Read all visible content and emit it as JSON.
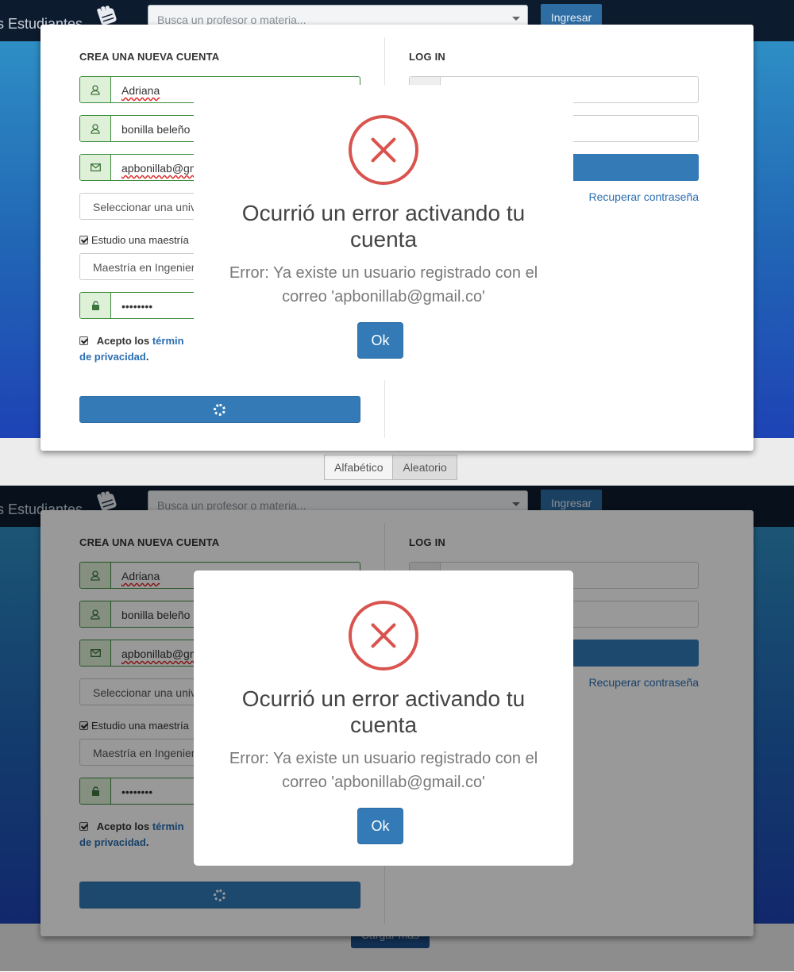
{
  "header": {
    "brand_text": "s Estudiantes",
    "search_placeholder": "Busca un profesor o materia...",
    "login_button": "Ingresar"
  },
  "sort": {
    "options": [
      "Alfabético",
      "Aleatorio"
    ],
    "active": "Aleatorio"
  },
  "load_more_label": "Cargar más",
  "register": {
    "title": "CREA UNA NUEVA CUENTA",
    "first_name": "Adriana",
    "last_name": "bonilla beleño",
    "email": "apbonillab@gm",
    "university": "Seleccionar una univ",
    "masters_checkbox_label": "Estudio una maestría",
    "masters_program": "Maestría en Ingenier",
    "password": "••••••••",
    "terms_prefix": "Acepto los ",
    "terms_link": "términ",
    "privacy_link": "de privacidad",
    "privacy_suffix": "."
  },
  "login": {
    "title": "LOG IN",
    "recover_link": "Recuperar contraseña"
  },
  "modal": {
    "icon": "error-x-icon",
    "title": "Ocurrió un error activando tu cuenta",
    "message": "Error: Ya existe un usuario registrado con el correo 'apbonillab@gmail.co'",
    "ok_button": "Ok"
  },
  "colors": {
    "primary": "#337ab7",
    "error": "#d9534f",
    "valid": "#3c8a3c",
    "navbar": "#0d1b2e"
  }
}
